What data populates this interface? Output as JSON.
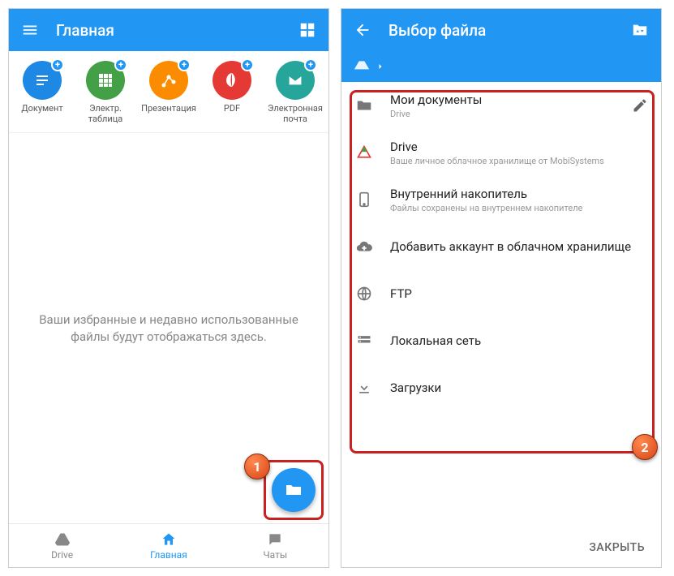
{
  "left": {
    "title": "Главная",
    "quick": [
      {
        "label": "Документ",
        "bg": "#1e88e5"
      },
      {
        "label": "Электр. таблица",
        "bg": "#43a047"
      },
      {
        "label": "Презентация",
        "bg": "#fb8c00"
      },
      {
        "label": "PDF",
        "bg": "#e53935"
      },
      {
        "label": "Электронная почта",
        "bg": "#26a69a"
      }
    ],
    "empty_text": "Ваши избранные и недавно использованные файлы будут отображаться здесь.",
    "nav": [
      {
        "label": "Drive"
      },
      {
        "label": "Главная"
      },
      {
        "label": "Чаты"
      }
    ],
    "marker": "1"
  },
  "right": {
    "title": "Выбор файла",
    "locations": [
      {
        "title": "Мои документы",
        "sub": "Drive",
        "edit": true
      },
      {
        "title": "Drive",
        "sub": "Ваше личное облачное хранилище от MobiSystems"
      },
      {
        "title": "Внутренний накопитель",
        "sub": "Файлы сохранены на внутреннем накопителе"
      },
      {
        "title": "Добавить аккаунт в облачном хранилище"
      },
      {
        "title": "FTP"
      },
      {
        "title": "Локальная сеть"
      },
      {
        "title": "Загрузки"
      }
    ],
    "close": "ЗАКРЫТЬ",
    "marker": "2"
  }
}
